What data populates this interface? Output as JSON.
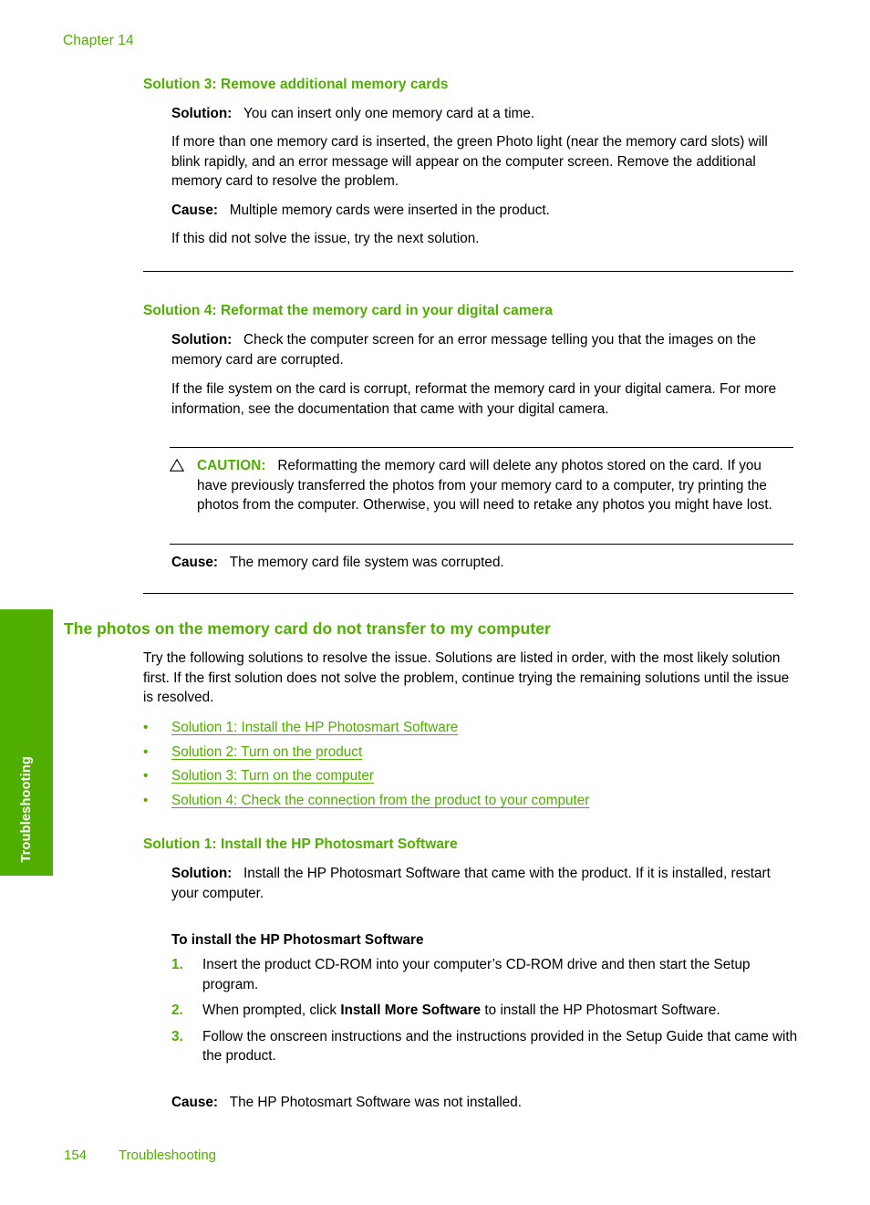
{
  "header": {
    "chapter": "Chapter 14"
  },
  "thumb_tab": {
    "label": "Troubleshooting",
    "color": "#4FAE00"
  },
  "colors": {
    "green": "#4FAE00",
    "link_green": "#4FAE00",
    "text": "#000000"
  },
  "sections": {
    "solution3": {
      "heading": "Solution 3: Remove additional memory cards",
      "solution_label": "Solution:",
      "solution_text": "You can insert only one memory card at a time.",
      "paragraph": "If more than one memory card is inserted, the green Photo light (near the memory card slots) will blink rapidly, and an error message will appear on the computer screen. Remove the additional memory card to resolve the problem.",
      "cause_label": "Cause:",
      "cause_text": "Multiple memory cards were inserted in the product.",
      "next_text": "If this did not solve the issue, try the next solution."
    },
    "solution4": {
      "heading": "Solution 4: Reformat the memory card in your digital camera",
      "solution_label": "Solution:",
      "solution_text": "Check the computer screen for an error message telling you that the images on the memory card are corrupted.",
      "paragraph": "If the file system on the card is corrupt, reformat the memory card in your digital camera. For more information, see the documentation that came with your digital camera.",
      "caution_label": "CAUTION:",
      "caution_text": "Reformatting the memory card will delete any photos stored on the card. If you have previously transferred the photos from your memory card to a computer, try printing the photos from the computer. Otherwise, you will need to retake any photos you might have lost.",
      "caution_icon": "warning-triangle-icon",
      "cause_label": "Cause:",
      "cause_text": "The memory card file system was corrupted."
    },
    "transfer": {
      "heading": "The photos on the memory card do not transfer to my computer",
      "intro": "Try the following solutions to resolve the issue. Solutions are listed in order, with the most likely solution first. If the first solution does not solve the problem, continue trying the remaining solutions until the issue is resolved.",
      "links": [
        {
          "bullet": "•",
          "label": "Solution 1: Install the HP Photosmart Software"
        },
        {
          "bullet": "•",
          "label": "Solution 2: Turn on the product"
        },
        {
          "bullet": "•",
          "label": "Solution 3: Turn on the computer"
        },
        {
          "bullet": "•",
          "label": "Solution 4: Check the connection from the product to your computer"
        }
      ]
    },
    "solution1": {
      "heading": "Solution 1: Install the HP Photosmart Software",
      "solution_label": "Solution:",
      "solution_text": "Install the HP Photosmart Software that came with the product. If it is installed, restart your computer.",
      "procedure_title": "To install the HP Photosmart Software",
      "steps": [
        {
          "num": "1.",
          "text_before": "Insert the product CD-ROM into your computer’s CD-ROM drive and then start the Setup program.",
          "bold": "",
          "text_after": ""
        },
        {
          "num": "2.",
          "text_before": "When prompted, click ",
          "bold": "Install More Software",
          "text_after": " to install the HP Photosmart Software."
        },
        {
          "num": "3.",
          "text_before": "Follow the onscreen instructions and the instructions provided in the Setup Guide that came with the product.",
          "bold": "",
          "text_after": ""
        }
      ],
      "cause_label": "Cause:",
      "cause_text": "The HP Photosmart Software was not installed."
    }
  },
  "footer": {
    "page_number": "154",
    "section_label": "Troubleshooting"
  }
}
